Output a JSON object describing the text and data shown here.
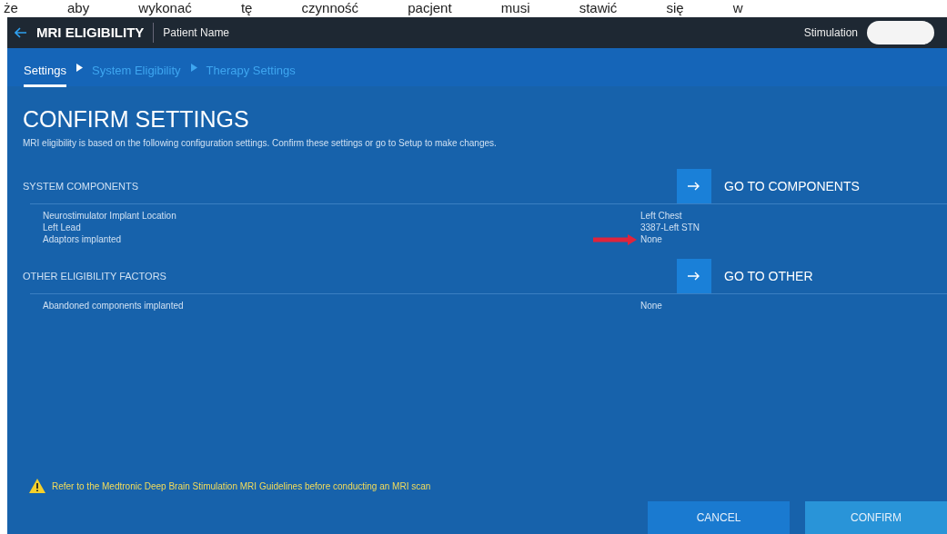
{
  "document_text": "że aby wykonać tę czynność pacjent musi stawić się w",
  "header": {
    "title": "MRI ELIGIBILITY",
    "patient": "Patient Name",
    "stimulation_label": "Stimulation"
  },
  "breadcrumb": [
    {
      "label": "Settings",
      "selected": true
    },
    {
      "label": "System Eligibility",
      "selected": false
    },
    {
      "label": "Therapy Settings",
      "selected": false
    }
  ],
  "page": {
    "title": "CONFIRM SETTINGS",
    "description": "MRI eligibility is based on the following configuration settings. Confirm these settings or go to Setup to make changes."
  },
  "sections": [
    {
      "title": "SYSTEM COMPONENTS",
      "action": "GO TO COMPONENTS",
      "rows": [
        {
          "label": "Neurostimulator Implant Location",
          "value": "Left Chest",
          "highlighted": false
        },
        {
          "label": "Left Lead",
          "value": "3387-Left STN",
          "highlighted": false
        },
        {
          "label": "Adaptors implanted",
          "value": "None",
          "highlighted": true
        }
      ]
    },
    {
      "title": "OTHER ELIGIBILITY FACTORS",
      "action": "GO TO OTHER",
      "rows": [
        {
          "label": "Abandoned components implanted",
          "value": "None",
          "highlighted": false
        }
      ]
    }
  ],
  "warning": "Refer to the Medtronic Deep Brain Stimulation MRI Guidelines before conducting an MRI scan",
  "buttons": [
    {
      "label": "CANCEL",
      "kind": "secondary"
    },
    {
      "label": "CONFIRM",
      "kind": "primary"
    }
  ]
}
